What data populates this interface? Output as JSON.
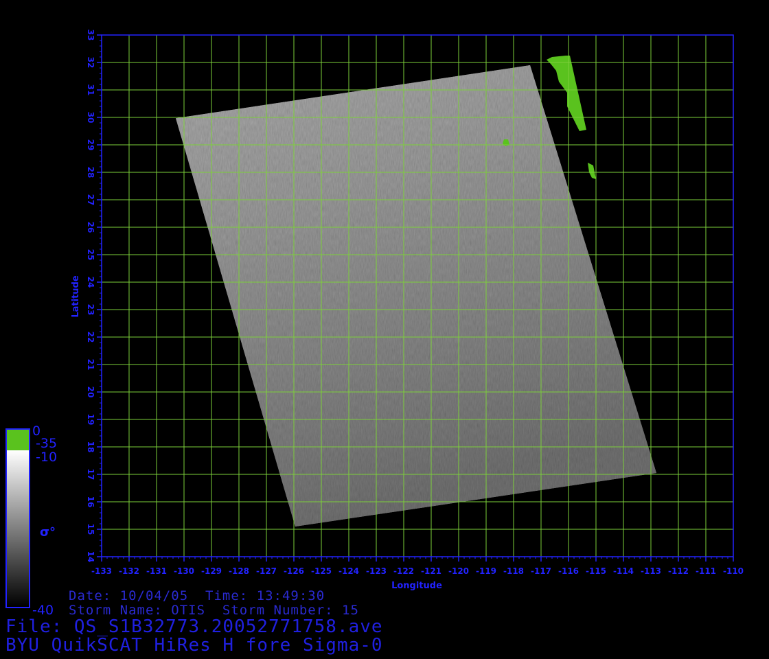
{
  "map": {
    "lon_range": [
      -133,
      -110
    ],
    "lat_range": [
      14,
      33
    ],
    "lon_ticks": [
      "-133",
      "-132",
      "-131",
      "-130",
      "-129",
      "-128",
      "-127",
      "-126",
      "-125",
      "-124",
      "-123",
      "-122",
      "-121",
      "-120",
      "-119",
      "-118",
      "-117",
      "-116",
      "-115",
      "-114",
      "-113",
      "-112",
      "-111",
      "-110"
    ],
    "lat_ticks": [
      "14",
      "15",
      "16",
      "17",
      "18",
      "19",
      "20",
      "21",
      "22",
      "23",
      "24",
      "25",
      "26",
      "27",
      "28",
      "29",
      "30",
      "31",
      "32",
      "33"
    ],
    "xlabel": "Longitude",
    "ylabel": "Latitude",
    "grid": true,
    "grid_color": "#7ccf3a",
    "axis_color": "#2222ff",
    "land_color": "#5ac21e",
    "swath_corners": [
      {
        "lon": -130.3,
        "lat": 29.97
      },
      {
        "lon": -117.4,
        "lat": 31.9
      },
      {
        "lon": -112.8,
        "lat": 17.05
      },
      {
        "lon": -125.95,
        "lat": 15.1
      }
    ]
  },
  "colorbar": {
    "label": "σ°",
    "labels": {
      "top": "0",
      "land": "-35",
      "high": "-10",
      "low": "-40"
    },
    "land_color": "#5ac21e",
    "frame_color": "#2222ff"
  },
  "info": {
    "line1": "Date: 10/04/05  Time: 13:49:30",
    "line2": "Storm Name: OTIS  Storm Number: 15",
    "file_line": "File: QS_S1B32773.20052771758.ave",
    "product_line": "BYU QuikSCAT HiRes H fore Sigma-0"
  }
}
